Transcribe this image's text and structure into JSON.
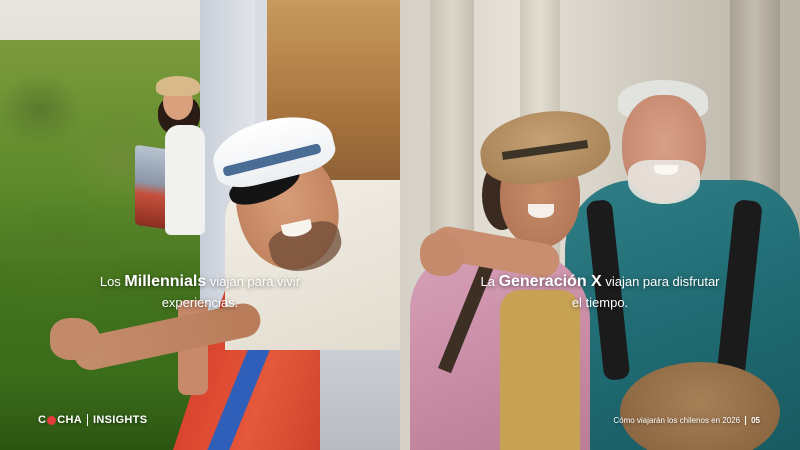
{
  "left_panel": {
    "caption": {
      "prefix": "Los ",
      "highlight": "Millennials",
      "suffix_line1": " viajan para vivir",
      "line2": "experiencias."
    }
  },
  "right_panel": {
    "caption": {
      "prefix": "La ",
      "highlight": "Generación X",
      "suffix_line1": " viajan para disfrutar",
      "line2": "el tiempo."
    }
  },
  "brand": {
    "name_part1": "C",
    "name_part2": "CHA",
    "section": "INSIGHTS",
    "accent_color": "#e43b3b"
  },
  "footer": {
    "title": "Cómo viajarán los chilenos en 2026",
    "page_number": "05"
  }
}
